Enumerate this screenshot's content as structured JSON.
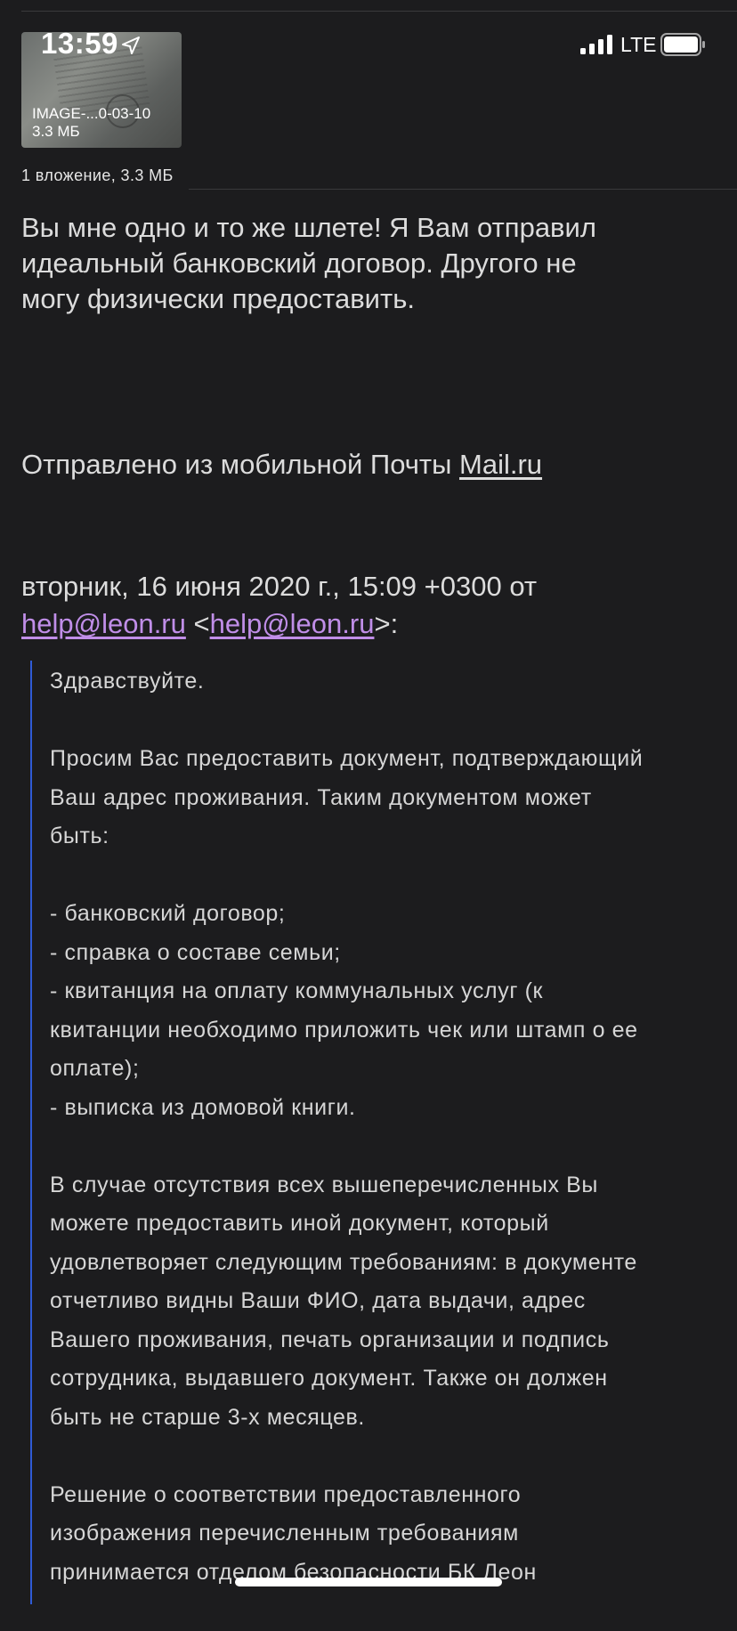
{
  "status_bar": {
    "time": "13:59",
    "network": "LTE"
  },
  "attachment": {
    "name": "IMAGE-...0-03-10",
    "size": "3.3 МБ",
    "summary": "1 вложение, 3.3 МБ"
  },
  "reply": {
    "lines": [
      "Вы мне одно и то же шлете! Я Вам отправил",
      "идеальный банковский договор. Другого не",
      "могу физически предоставить."
    ]
  },
  "signature": {
    "prefix": "Отправлено из мобильной Почты ",
    "link": "Mail.ru"
  },
  "quote_header": {
    "line1": "вторник, 16 июня 2020 г., 15:09 +0300 от",
    "email1": "help@leon.ru",
    "open_bracket": " <",
    "email2": "help@leon.ru",
    "close": ">:"
  },
  "quote": {
    "greeting": "Здравствуйте.",
    "request_lines": [
      "Просим Вас предоставить документ, подтверждающий",
      "Ваш адрес проживания. Таким документом может",
      "быть:"
    ],
    "list_lines": [
      "- банковский договор;",
      "- справка о составе семьи;",
      "- квитанция на оплату коммунальных услуг (к",
      "квитанции необходимо приложить чек или штамп о ее",
      "оплате);",
      "- выписка из домовой книги."
    ],
    "alt_lines": [
      "В случае отсутствия всех вышеперечисленных Вы",
      "можете предоставить иной документ, который",
      "удовлетворяет следующим требованиям: в документе",
      "отчетливо видны Ваши ФИО, дата выдачи, адрес",
      "Вашего проживания, печать организации и подпись",
      "сотрудника, выдавшего документ. Также он должен",
      "быть не старше 3-х месяцев."
    ],
    "decision_lines": [
      "Решение о соответствии предоставленного",
      "изображения перечисленным требованиям",
      "принимается отделом безопасности БК Леон"
    ]
  },
  "colors": {
    "background": "#1c1c1e",
    "link": "#c08ee8",
    "quote_bar": "#2f5bd6"
  }
}
